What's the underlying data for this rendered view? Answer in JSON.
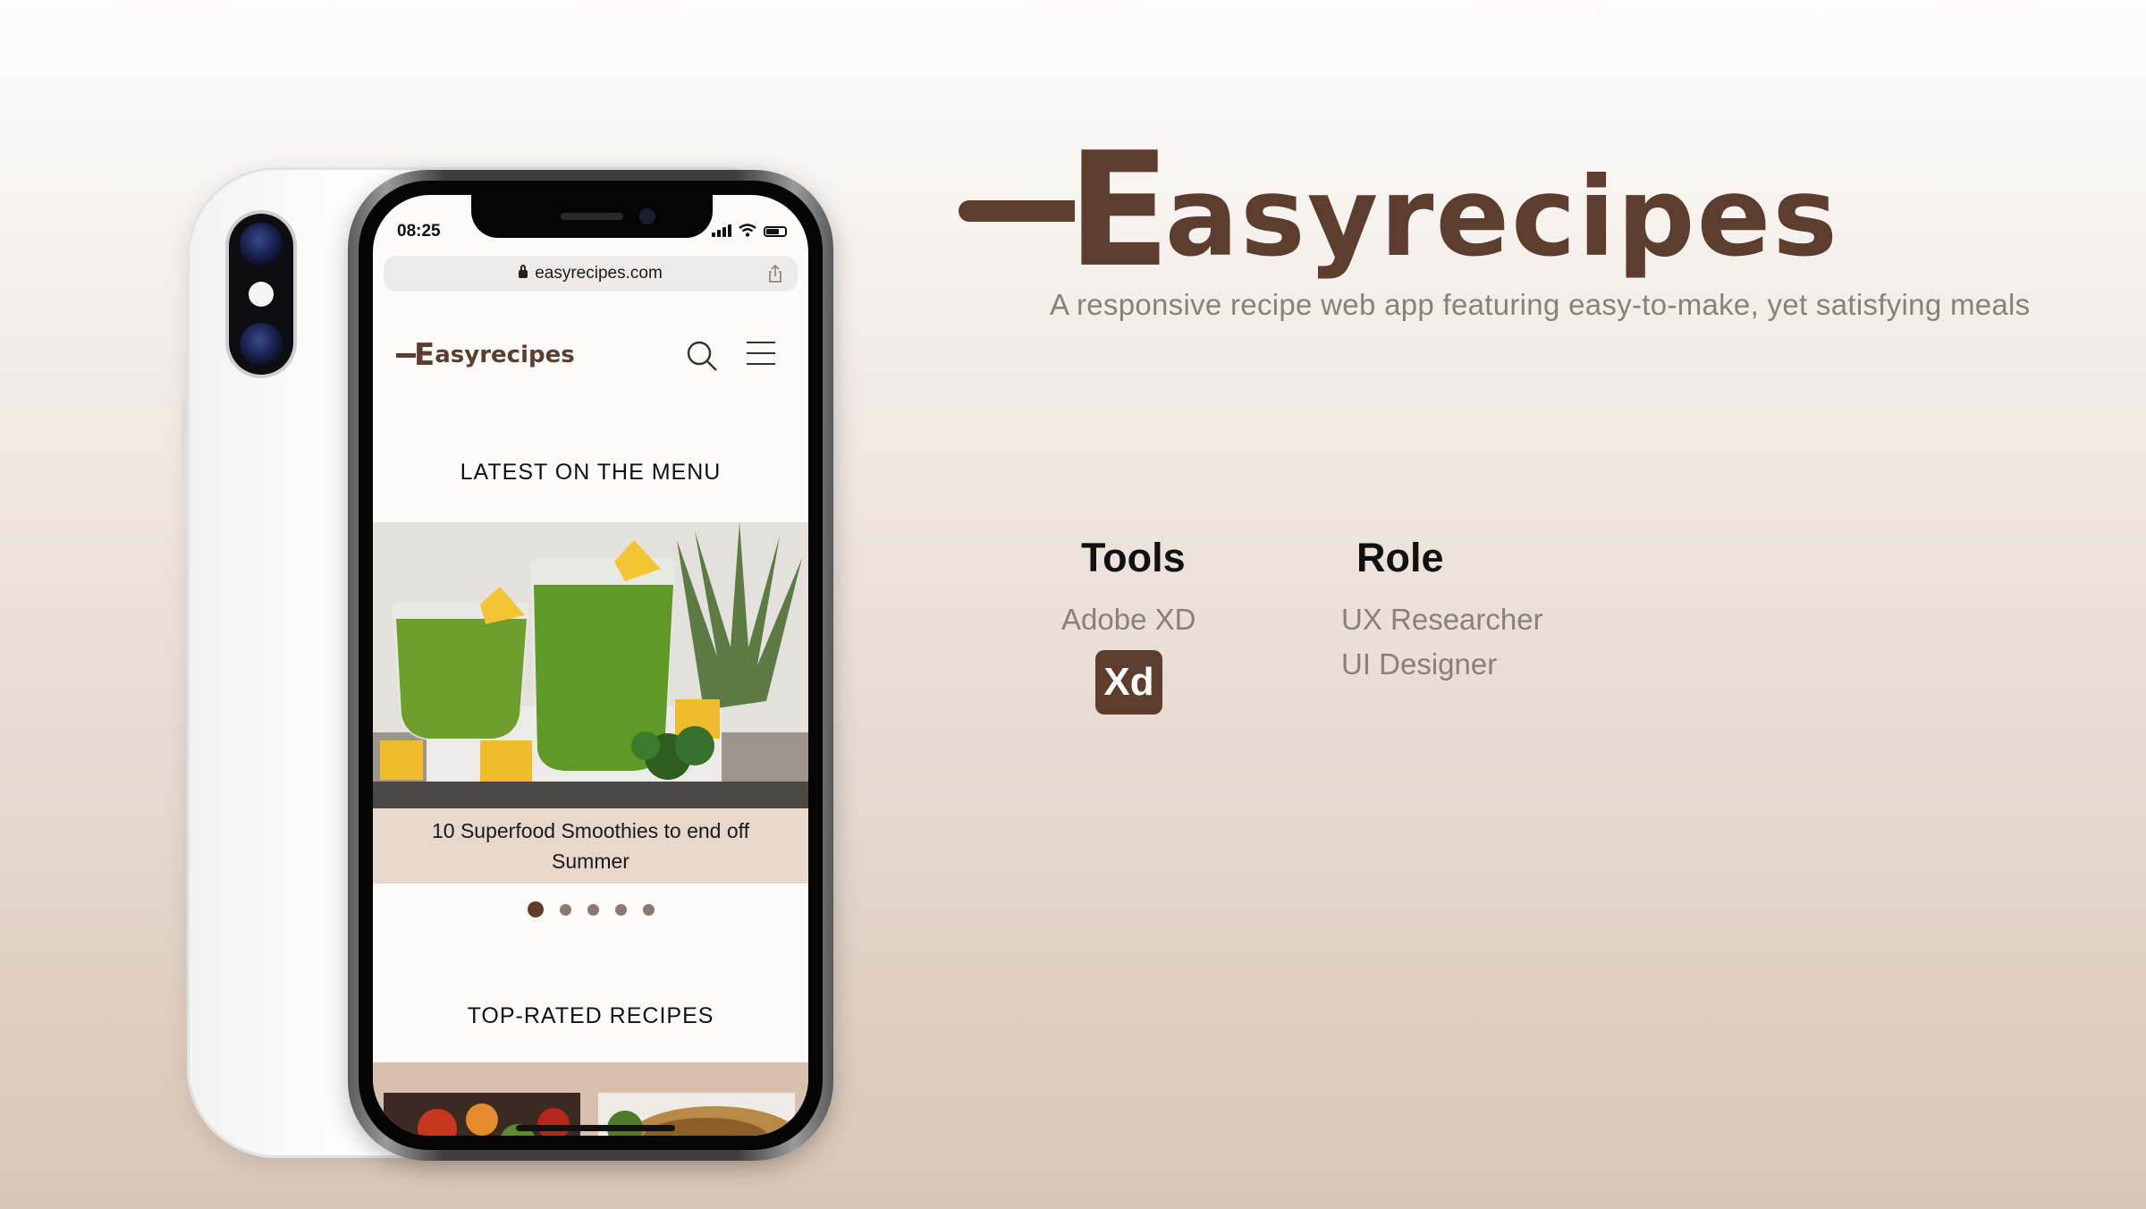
{
  "phone": {
    "status_time": "08:25",
    "url": "easyrecipes.com",
    "site": {
      "logo_initial": "E",
      "logo_rest": "asyrecipes"
    },
    "latest_title": "LATEST ON THE MENU",
    "carousel": {
      "caption": "10 Superfood Smoothies to end off Summer",
      "slide_count": 5,
      "active_index": 0
    },
    "toprated_title": "TOP-RATED RECIPES"
  },
  "brand": {
    "initial": "E",
    "rest": "asyrecipes",
    "tagline": "A responsive recipe web app featuring easy-to-make, yet satisfying meals"
  },
  "tools": {
    "heading": "Tools",
    "items": [
      "Adobe XD"
    ],
    "badge": "Xd"
  },
  "role": {
    "heading": "Role",
    "items": [
      "UX Researcher",
      "UI Designer"
    ]
  },
  "colors": {
    "brand_brown": "#5c3d2e",
    "caption_bg": "#e7d8cb",
    "muted_text": "#8a807a"
  }
}
